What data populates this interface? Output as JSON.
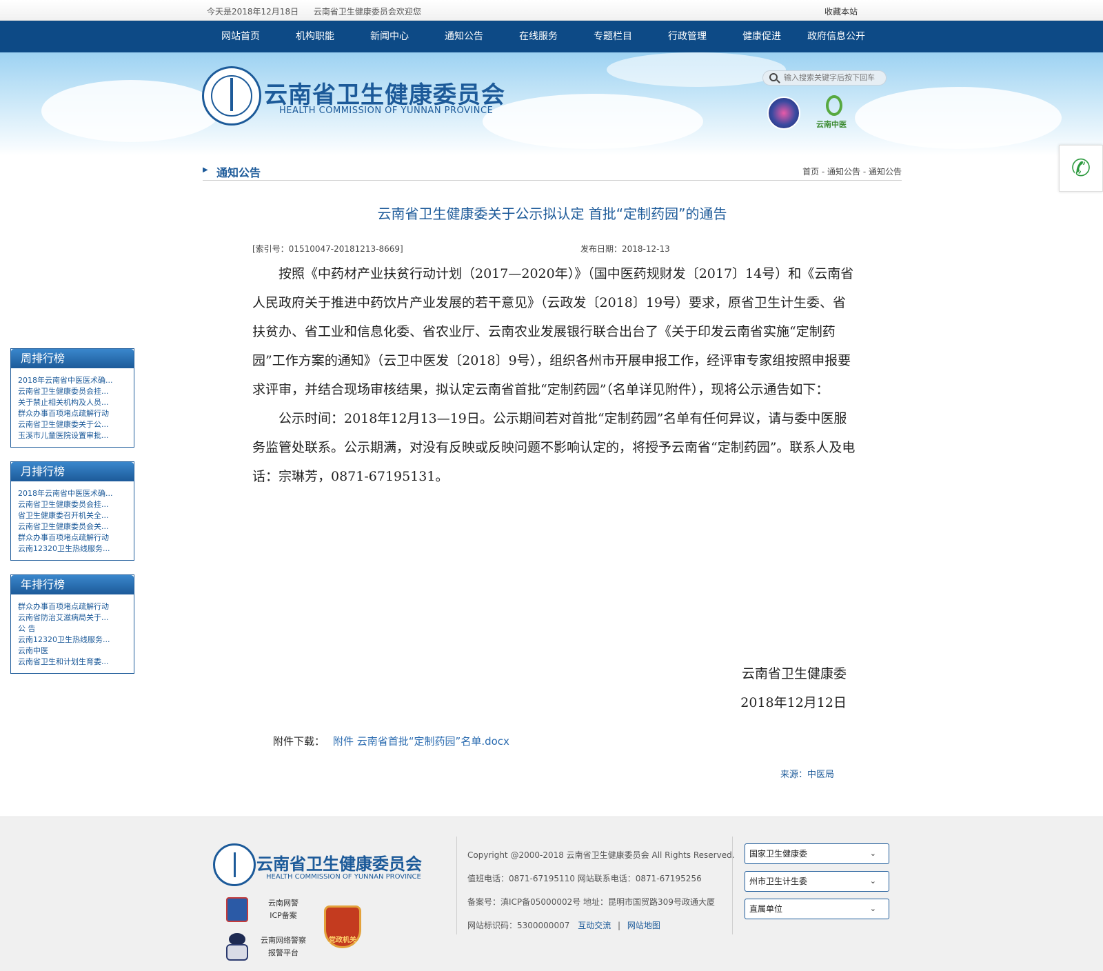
{
  "topbar": {
    "date": "今天是2018年12月18日",
    "welcome": "云南省卫生健康委员会欢迎您",
    "bookmark": "收藏本站"
  },
  "nav": [
    "网站首页",
    "机构职能",
    "新闻中心",
    "通知公告",
    "在线服务",
    "专题栏目",
    "行政管理",
    "健康促进",
    "政府信息公开"
  ],
  "header": {
    "org_name": "云南省卫生健康委员会",
    "org_name_en": "HEALTH COMMISSION OF YUNNAN PROVINCE",
    "search_placeholder": "输入搜索关键字后按下回车",
    "badge2_text": "云南中医"
  },
  "breadcrumb": {
    "section": "通知公告",
    "path": "首页 - 通知公告 - 通知公告"
  },
  "article": {
    "title": "云南省卫生健康委关于公示拟认定 首批“定制药园”的通告",
    "index_no": "[索引号：01510047-20181213-8669]",
    "publish_date": "发布日期：2018-12-13",
    "paragraphs": [
      "按照《中药材产业扶贫行动计划（2017—2020年）》（国中医药规财发〔2017〕14号）和《云南省人民政府关于推进中药饮片产业发展的若干意见》（云政发〔2018〕19号）要求，原省卫生计生委、省扶贫办、省工业和信息化委、省农业厅、云南农业发展银行联合出台了《关于印发云南省实施“定制药园”工作方案的通知》（云卫中医发〔2018〕9号），组织各州市开展申报工作，经评审专家组按照申报要求评审，并结合现场审核结果，拟认定云南省首批“定制药园”（名单详见附件），现将公示通告如下：",
      "公示时间：2018年12月13—19日。公示期间若对首批“定制药园”名单有任何异议，请与委中医服务监管处联系。公示期满，对没有反映或反映问题不影响认定的，将授予云南省“定制药园”。联系人及电话：宗琳芳，0871-67195131。"
    ],
    "signer": "云南省卫生健康委",
    "sign_date": "2018年12月12日",
    "attachment_label": "附件下载：",
    "attachment_link": "附件 云南省首批“定制药园”名单.docx",
    "source": "来源：中医局"
  },
  "rankings": [
    {
      "title": "周排行榜",
      "items": [
        "2018年云南省中医医术确...",
        "云南省卫生健康委员会挂...",
        "关于禁止相关机构及人员...",
        "群众办事百项堵点疏解行动",
        "云南省卫生健康委关于公...",
        "玉溪市儿童医院设置审批..."
      ]
    },
    {
      "title": "月排行榜",
      "items": [
        "2018年云南省中医医术确...",
        "云南省卫生健康委员会挂...",
        "省卫生健康委召开机关全...",
        "云南省卫生健康委员会关...",
        "群众办事百项堵点疏解行动",
        "云南12320卫生热线服务..."
      ]
    },
    {
      "title": "年排行榜",
      "items": [
        "群众办事百项堵点疏解行动",
        "云南省防治艾滋病局关于...",
        "公  告",
        "云南12320卫生热线服务...",
        "云南中医",
        "云南省卫生和计划生育委..."
      ]
    }
  ],
  "footer": {
    "org_name": "云南省卫生健康委员会",
    "org_name_en": "HEALTH COMMISSION OF YUNNAN PROVINCE",
    "police_label_1": "云南网警",
    "police_label_2": "ICP备案",
    "report_label_1": "云南网络警察",
    "report_label_2": "报警平台",
    "party_badge": "党政机关",
    "copyright": "Copyright @2000-2018  云南省卫生健康委员会  All Rights Reserved.",
    "phones": "值班电话：0871-67195110   网站联系电话：0871-67195256",
    "icp": "备案号：滇ICP备05000002号   地址：昆明市国贸路309号政通大厦",
    "site_id": "网站标识码：5300000007",
    "link_interact": "互动交流",
    "separator": "|",
    "link_sitemap": "网站地图",
    "selects": [
      "国家卫生健康委",
      "州市卫生计生委",
      "直属单位"
    ]
  }
}
